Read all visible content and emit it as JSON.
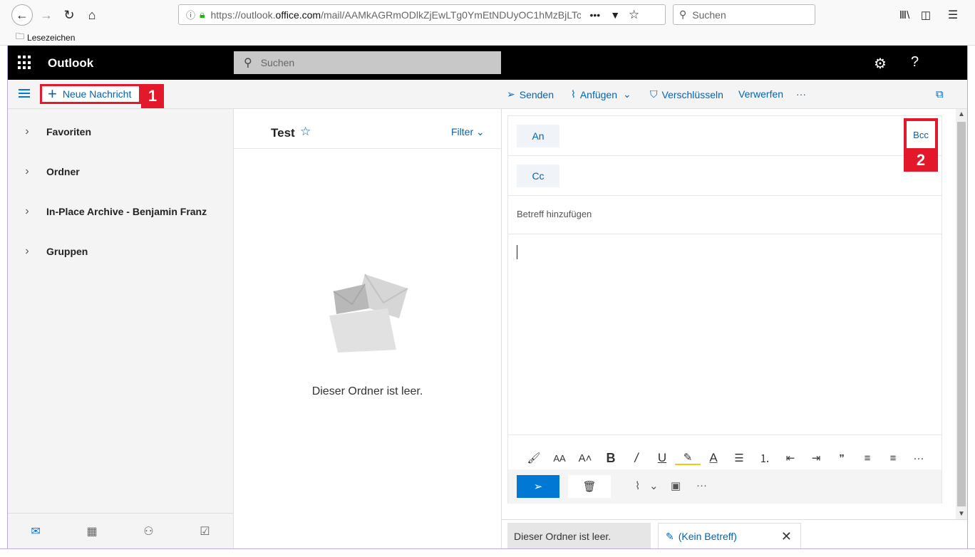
{
  "browser": {
    "url_prefix": "https://outlook.",
    "url_domain": "office.com",
    "url_rest": "/mail/AAMkAGRmODlkZjEwLTg0YmEtNDUyOC1hMzBjLTc3",
    "search_placeholder": "Suchen",
    "bookmarks_label": "Lesezeichen"
  },
  "header": {
    "app_title": "Outlook",
    "search_placeholder": "Suchen"
  },
  "command_bar": {
    "new_message": "Neue Nachricht",
    "badge_1": "1",
    "send": "Senden",
    "attach": "Anfügen",
    "encrypt": "Verschlüsseln",
    "discard": "Verwerfen",
    "more": "···"
  },
  "left_nav": {
    "items": [
      {
        "label": "Favoriten"
      },
      {
        "label": "Ordner"
      },
      {
        "label": "In-Place Archive - Benjamin Franz"
      },
      {
        "label": "Gruppen"
      }
    ]
  },
  "message_list": {
    "folder_title": "Test",
    "filter_label": "Filter",
    "empty_text": "Dieser Ordner ist leer."
  },
  "compose": {
    "to_label": "An",
    "cc_label": "Cc",
    "bcc_label": "Bcc",
    "badge_2": "2",
    "subject_placeholder": "Betreff hinzufügen"
  },
  "bottom_tabs": {
    "tab1": "Dieser Ordner ist leer.",
    "tab2": "(Kein Betreff)"
  },
  "colors": {
    "accent": "#0078d4",
    "link": "#0064b4",
    "highlight": "#e3192b"
  }
}
